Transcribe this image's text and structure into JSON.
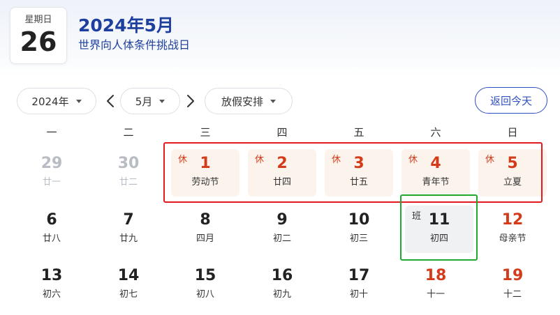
{
  "header": {
    "weekday": "星期日",
    "day": "26",
    "title": "2024年5月",
    "subtitle": "世界向人体条件挑战日"
  },
  "controls": {
    "year": "2024年",
    "month": "5月",
    "holiday": "放假安排",
    "today": "返回今天"
  },
  "weekdays": [
    "一",
    "二",
    "三",
    "四",
    "五",
    "六",
    "日"
  ],
  "weeks": [
    [
      {
        "num": "29",
        "lunar": "廿一",
        "kind": "other"
      },
      {
        "num": "30",
        "lunar": "廿二",
        "kind": "other"
      },
      {
        "num": "1",
        "lunar": "劳动节",
        "kind": "holiday",
        "tag": "休"
      },
      {
        "num": "2",
        "lunar": "廿四",
        "kind": "holiday",
        "tag": "休"
      },
      {
        "num": "3",
        "lunar": "廿五",
        "kind": "holiday",
        "tag": "休"
      },
      {
        "num": "4",
        "lunar": "青年节",
        "kind": "holiday",
        "tag": "休"
      },
      {
        "num": "5",
        "lunar": "立夏",
        "kind": "holiday",
        "tag": "休"
      }
    ],
    [
      {
        "num": "6",
        "lunar": "廿八",
        "kind": "normal"
      },
      {
        "num": "7",
        "lunar": "廿九",
        "kind": "normal"
      },
      {
        "num": "8",
        "lunar": "四月",
        "kind": "normal"
      },
      {
        "num": "9",
        "lunar": "初二",
        "kind": "normal"
      },
      {
        "num": "10",
        "lunar": "初三",
        "kind": "normal"
      },
      {
        "num": "11",
        "lunar": "初四",
        "kind": "work",
        "tag": "班"
      },
      {
        "num": "12",
        "lunar": "母亲节",
        "kind": "weekend"
      }
    ],
    [
      {
        "num": "13",
        "lunar": "初六",
        "kind": "normal"
      },
      {
        "num": "14",
        "lunar": "初七",
        "kind": "normal"
      },
      {
        "num": "15",
        "lunar": "初八",
        "kind": "normal"
      },
      {
        "num": "16",
        "lunar": "初九",
        "kind": "normal"
      },
      {
        "num": "17",
        "lunar": "初十",
        "kind": "normal"
      },
      {
        "num": "18",
        "lunar": "十一",
        "kind": "weekend"
      },
      {
        "num": "19",
        "lunar": "十二",
        "kind": "weekend"
      }
    ]
  ],
  "colors": {
    "accent": "#2f4fc0",
    "title": "#1d3f9e",
    "holiday_red": "#d43b1a",
    "highlight_red": "#e2191d",
    "highlight_green": "#1faa2f"
  }
}
